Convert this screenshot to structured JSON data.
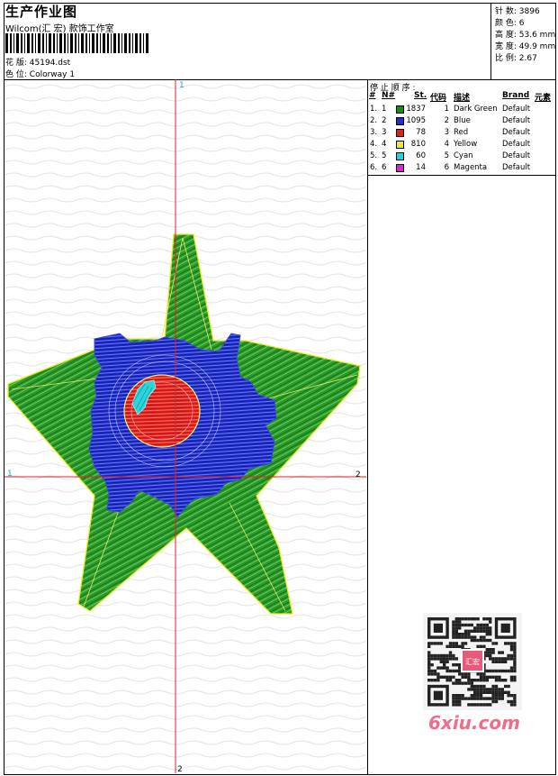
{
  "header": {
    "title": "生产作业图",
    "company": "Wilcom(汇 宏) 款饰工作室",
    "design_label": "花 版:",
    "design_file": "45194.dst",
    "colorway_label": "色 位:",
    "colorway": "Colorway 1"
  },
  "stats": [
    {
      "label": "针 数:",
      "value": "3896"
    },
    {
      "label": "颜 色:",
      "value": "6"
    },
    {
      "label": "高 度:",
      "value": "53.6 mm"
    },
    {
      "label": "宽 度:",
      "value": "49.9 mm"
    },
    {
      "label": "比 例:",
      "value": "2.67"
    }
  ],
  "stop_sequence": {
    "title": "停 止 顺 序 :",
    "headers": [
      "#",
      "N#",
      "St.",
      "代码",
      "描述",
      "Brand",
      "元素"
    ],
    "rows": [
      {
        "num": "1.",
        "needle": "1",
        "color": "#1a8a1a",
        "stitches": "1837",
        "code": "1",
        "desc": "Dark Green",
        "brand": "Default"
      },
      {
        "num": "2.",
        "needle": "2",
        "color": "#1f2fd6",
        "stitches": "1095",
        "code": "2",
        "desc": "Blue",
        "brand": "Default"
      },
      {
        "num": "3.",
        "needle": "3",
        "color": "#e51f1f",
        "stitches": "78",
        "code": "3",
        "desc": "Red",
        "brand": "Default"
      },
      {
        "num": "4.",
        "needle": "4",
        "color": "#f2ec1a",
        "stitches": "810",
        "code": "4",
        "desc": "Yellow",
        "brand": "Default"
      },
      {
        "num": "5.",
        "needle": "5",
        "color": "#25d2d8",
        "stitches": "60",
        "code": "5",
        "desc": "Cyan",
        "brand": "Default"
      },
      {
        "num": "6.",
        "needle": "6",
        "color": "#e022d6",
        "stitches": "14",
        "code": "6",
        "desc": "Magenta",
        "brand": "Default"
      }
    ]
  },
  "axes": {
    "top_marker": "1",
    "left_marker": "1",
    "right_marker": "2",
    "bottom_marker": "2",
    "color": "#e0202a"
  },
  "watermark": {
    "site": "6xiu.com",
    "stamp_text": "汇宏"
  }
}
